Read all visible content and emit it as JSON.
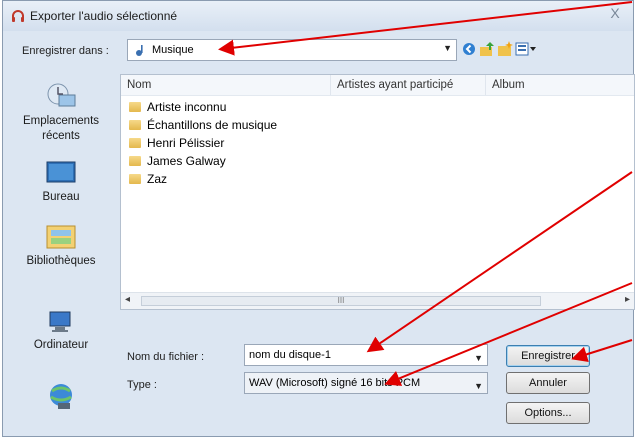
{
  "window": {
    "title": "Exporter l'audio sélectionné",
    "close_glyph": "X"
  },
  "save_in": {
    "label": "Enregistrer dans :",
    "value": "Musique"
  },
  "places": [
    {
      "label": "Emplacements récents",
      "icon": "recent-places-icon"
    },
    {
      "label": "Bureau",
      "icon": "desktop-icon"
    },
    {
      "label": "Bibliothèques",
      "icon": "libraries-icon"
    },
    {
      "label": "Ordinateur",
      "icon": "computer-icon"
    },
    {
      "label": "",
      "icon": "network-icon"
    }
  ],
  "columns": [
    "Nom",
    "Artistes ayant participé",
    "Album"
  ],
  "files": [
    "Artiste inconnu",
    "Échantillons de musique",
    "Henri Pélissier",
    "James Galway",
    "Zaz"
  ],
  "scrollbar": {
    "thumb_glyph": "III"
  },
  "filename": {
    "label": "Nom du fichier :",
    "value": "nom du disque-1"
  },
  "filetype": {
    "label": "Type :",
    "value": "WAV (Microsoft) signé 16 bits PCM"
  },
  "buttons": {
    "save": "Enregistrer",
    "cancel": "Annuler",
    "options": "Options..."
  },
  "colors": {
    "annotation_arrow": "#e00000",
    "dialog_bg": "#dce6f2"
  }
}
